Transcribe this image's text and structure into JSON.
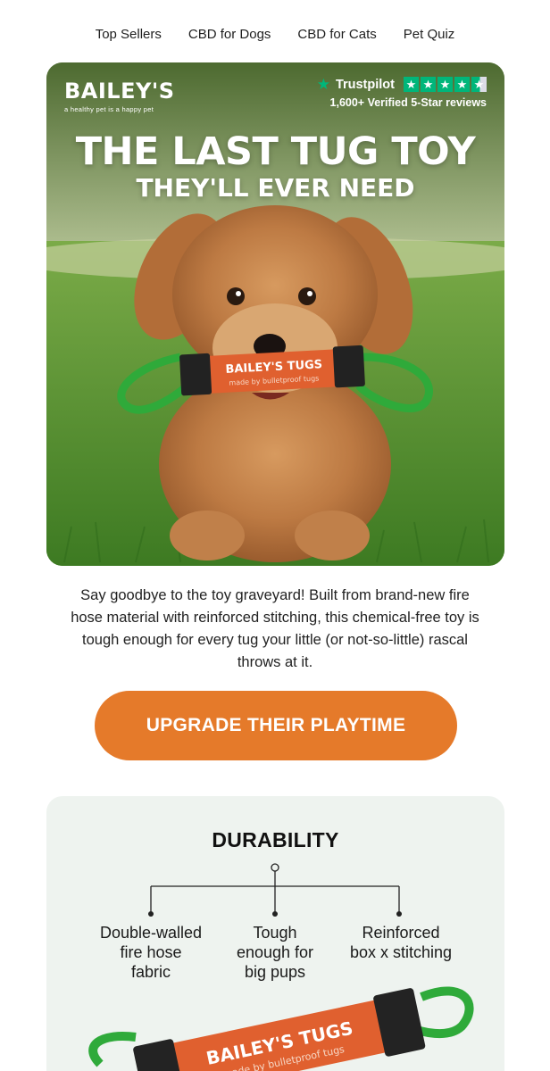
{
  "nav": {
    "items": [
      "Top Sellers",
      "CBD for Dogs",
      "CBD for Cats",
      "Pet Quiz"
    ]
  },
  "hero": {
    "brand_name": "BAILEY'S",
    "brand_tagline": "a healthy pet is a happy pet",
    "trustpilot_label": "Trustpilot",
    "trustpilot_reviews": "1,600+ Verified 5-Star reviews",
    "rating_stars": 4.5,
    "headline_line1": "THE LAST TUG TOY",
    "headline_line2": "THEY'LL EVER NEED",
    "toy_label": "BAILEY'S TUGS",
    "toy_sublabel": "made by bulletproof tugs"
  },
  "body_copy": "Say goodbye to the toy graveyard! Built from brand-new fire hose material with reinforced stitching, this chemical-free toy is tough enough for every tug your little (or not-so-little) rascal throws at it.",
  "cta": {
    "label": "UPGRADE THEIR PLAYTIME"
  },
  "durability": {
    "title": "DURABILITY",
    "features": [
      {
        "line1": "Double-walled",
        "line2": "fire hose",
        "line3": "fabric"
      },
      {
        "line1": "Tough",
        "line2": "enough for",
        "line3": "big pups"
      },
      {
        "line1": "Reinforced",
        "line2": "box x stitching",
        "line3": ""
      }
    ],
    "toy_label": "BAILEY'S TUGS",
    "toy_sublabel": "made by bulletproof tugs"
  },
  "colors": {
    "accent_orange": "#e57a2a",
    "trustpilot_green": "#00b67a",
    "panel_bg": "#eef3ef",
    "handle_green": "#2faa3a"
  },
  "icons": {
    "trustpilot_logo": "star-icon",
    "rating": "star-icon"
  }
}
